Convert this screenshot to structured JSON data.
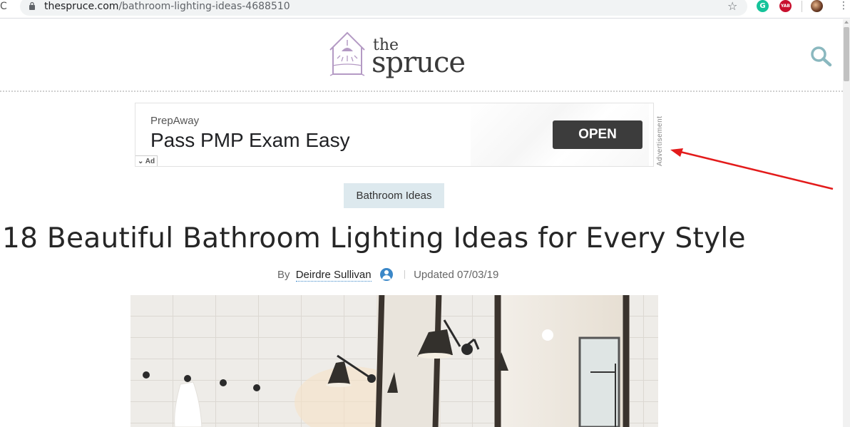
{
  "browser": {
    "url_host": "thespruce.com",
    "url_path": "/bathroom-lighting-ideas-4688510",
    "extensions": [
      {
        "name": "grammarly-icon",
        "label": "G"
      },
      {
        "name": "yab-icon",
        "label": "YAB"
      }
    ]
  },
  "site": {
    "logo_small": "the",
    "logo_large": "spruce"
  },
  "ad": {
    "brand": "PrepAway",
    "headline": "Pass PMP Exam Easy",
    "cta": "OPEN",
    "ad_badge": "Ad",
    "vertical_label": "Advertisement"
  },
  "article": {
    "category": "Bathroom Ideas",
    "title": "18 Beautiful Bathroom Lighting Ideas for Every Style",
    "byline_prefix": "By",
    "author": "Deirdre Sullivan",
    "updated": "Updated 07/03/19"
  },
  "colors": {
    "annotation_arrow": "#e31b1b",
    "tag_bg": "#dde9ee",
    "logo_accent": "#b49ac4",
    "search_icon": "#8ab8bf"
  }
}
